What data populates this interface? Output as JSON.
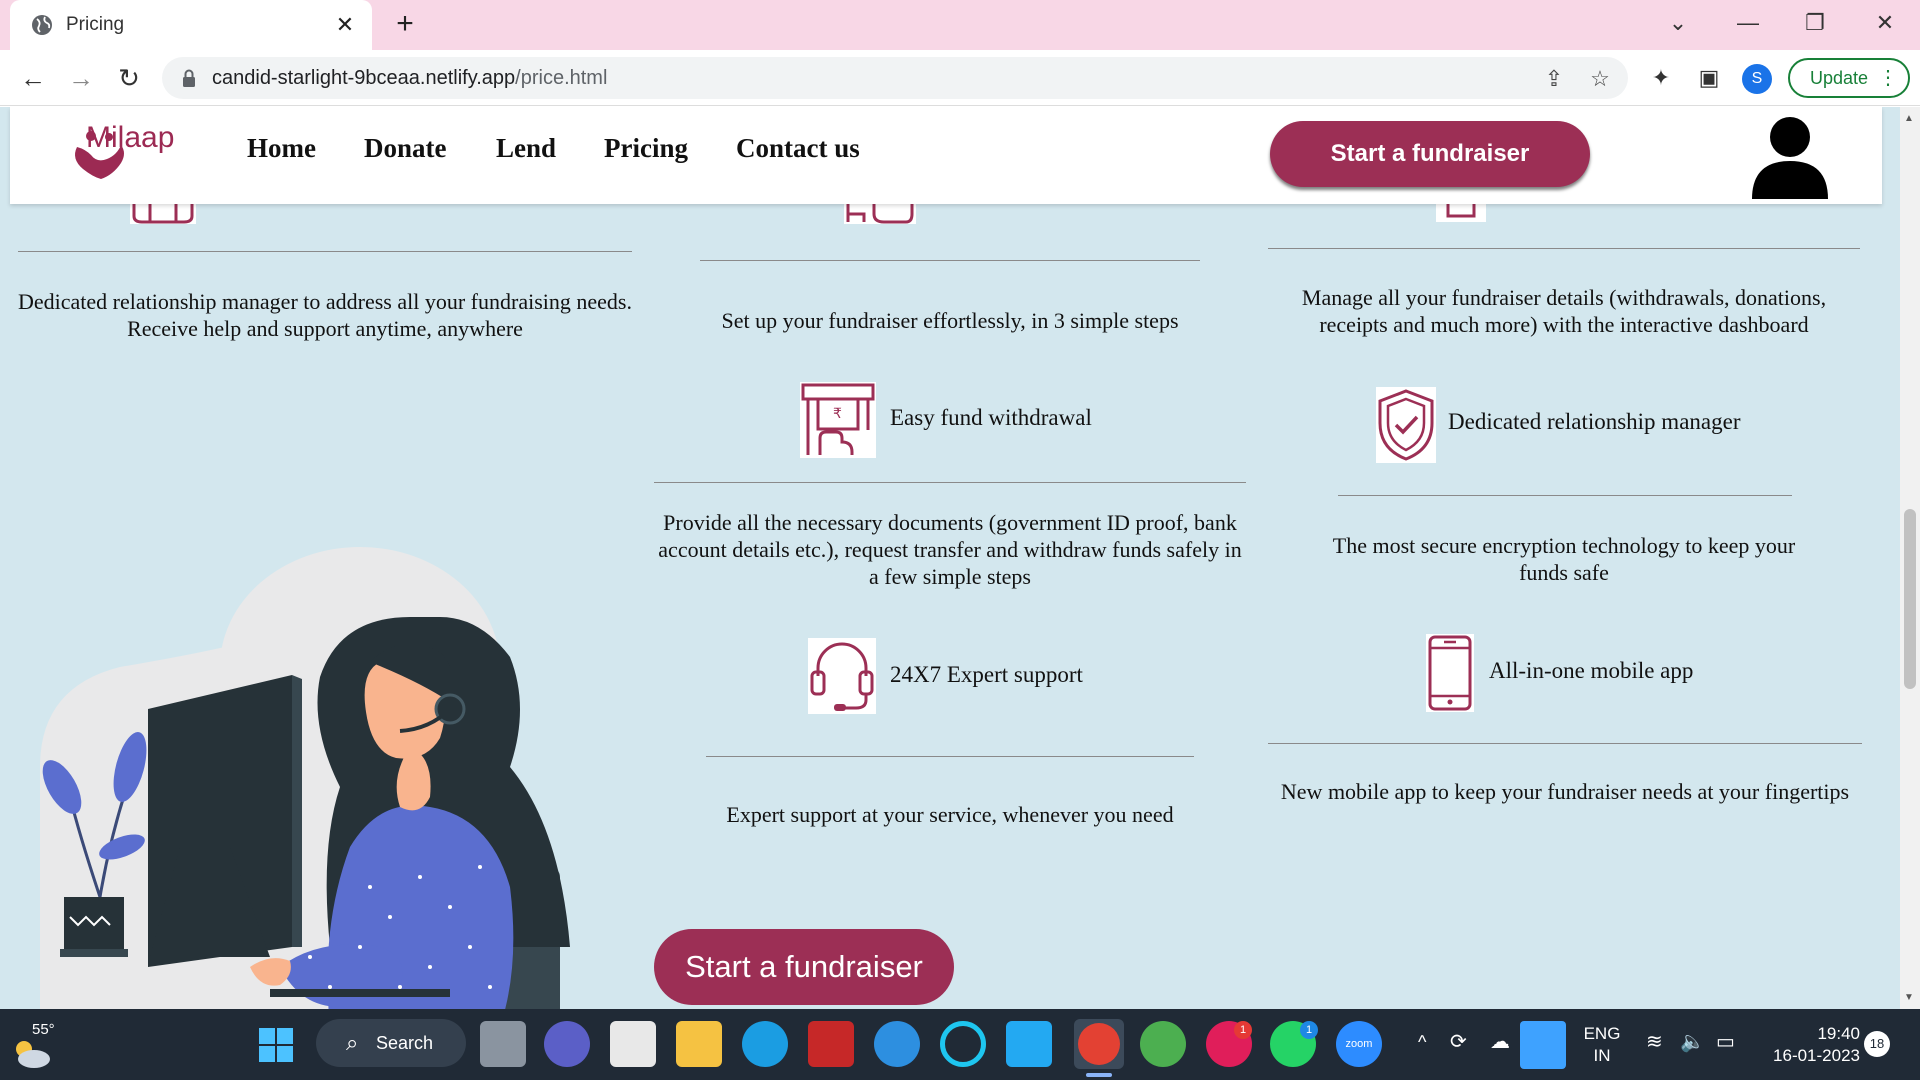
{
  "browser": {
    "tab_title": "Pricing",
    "url_host": "candid-starlight-9bceaa.netlify.app",
    "url_path": "/price.html",
    "profile_initial": "S",
    "update_label": "Update"
  },
  "site": {
    "logo_text": "Milaap",
    "nav": [
      "Home",
      "Donate",
      "Lend",
      "Pricing",
      "Contact us"
    ],
    "cta_top": "Start a fundraiser",
    "cta_bottom": "Start a fundraiser",
    "accent_color": "#9c2f55"
  },
  "features": {
    "col1_desc": "Dedicated relationship manager to address all your fundraising needs. Receive help and support anytime, anywhere",
    "col2_top_desc": "Set up your fundraiser effortlessly, in 3 simple steps",
    "col3_top_desc": "Manage all your fundraiser details (withdrawals, donations, receipts and much more) with the interactive dashboard",
    "withdrawal": {
      "label": "Easy fund withdrawal",
      "desc": "Provide all the necessary documents (government ID proof, bank account details etc.), request transfer and withdraw funds safely in a few simple steps",
      "icon": "atm-withdrawal-icon"
    },
    "manager": {
      "label": "Dedicated relationship manager",
      "desc": "The most secure encryption technology to keep your funds safe",
      "icon": "shield-check-icon"
    },
    "support": {
      "label": "24X7 Expert support",
      "desc": "Expert support at your service, whenever you need",
      "icon": "headset-icon"
    },
    "mobile": {
      "label": "All-in-one mobile app",
      "desc": "New mobile app to keep your fundraiser needs at your fingertips",
      "icon": "mobile-phone-icon"
    }
  },
  "taskbar": {
    "temperature": "55°",
    "search_label": "Search",
    "lang_top": "ENG",
    "lang_bottom": "IN",
    "time": "19:40",
    "date": "16-01-2023",
    "notifications": "18",
    "slack_badge": "1",
    "whatsapp_badge": "1",
    "zoom_label": "zoom"
  }
}
